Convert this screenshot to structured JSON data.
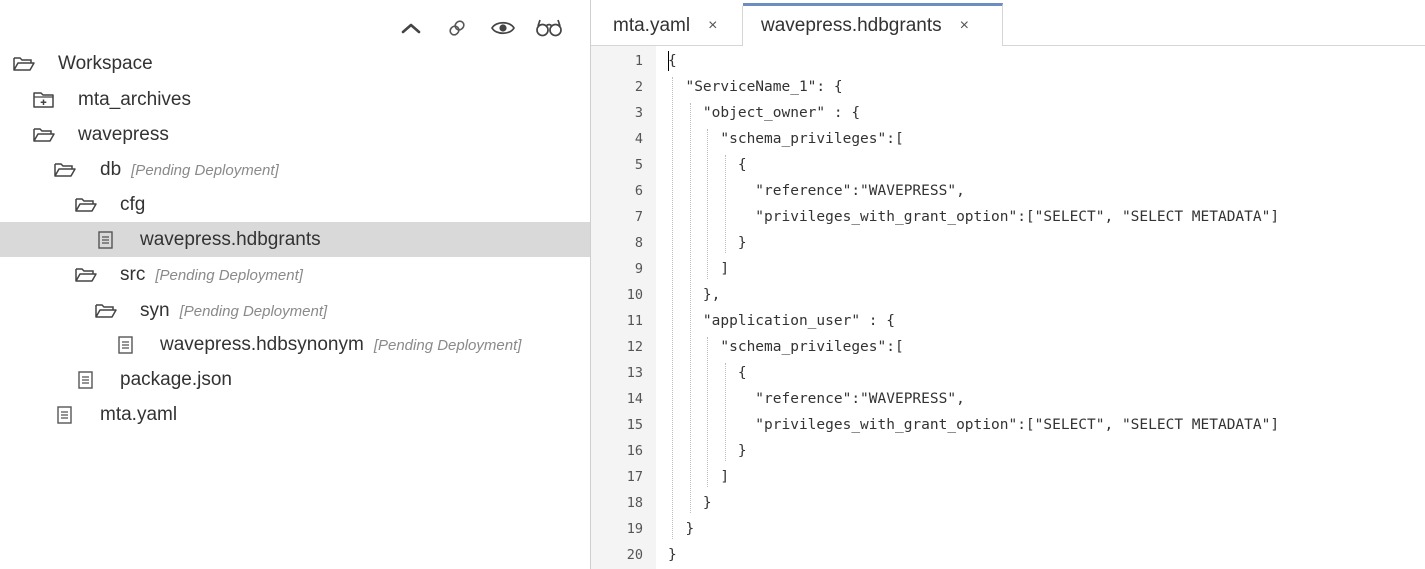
{
  "toolbar": {
    "icons": [
      "chevron-up-icon",
      "link-icon",
      "eye-icon",
      "glasses-icon"
    ]
  },
  "tree": {
    "items": [
      {
        "label": "Workspace",
        "tag": "",
        "icon": "folder-open-icon"
      },
      {
        "label": "mta_archives",
        "tag": "",
        "icon": "folder-plus-icon"
      },
      {
        "label": "wavepress",
        "tag": "",
        "icon": "folder-open-icon"
      },
      {
        "label": "db",
        "tag": "[Pending Deployment]",
        "icon": "folder-open-icon"
      },
      {
        "label": "cfg",
        "tag": "",
        "icon": "folder-open-icon"
      },
      {
        "label": "wavepress.hdbgrants",
        "tag": "",
        "icon": "file-icon",
        "selected": true
      },
      {
        "label": "src",
        "tag": "[Pending Deployment]",
        "icon": "folder-open-icon"
      },
      {
        "label": "syn",
        "tag": "[Pending Deployment]",
        "icon": "folder-open-icon"
      },
      {
        "label": "wavepress.hdbsynonym",
        "tag": "[Pending Deployment]",
        "icon": "file-icon"
      },
      {
        "label": "package.json",
        "tag": "",
        "icon": "file-icon"
      },
      {
        "label": "mta.yaml",
        "tag": "",
        "icon": "file-icon"
      }
    ]
  },
  "editor": {
    "tabs": [
      {
        "label": "mta.yaml",
        "close": "×",
        "active": false
      },
      {
        "label": "wavepress.hdbgrants",
        "close": "×",
        "active": true
      }
    ],
    "line_numbers": [
      "1",
      "2",
      "3",
      "4",
      "5",
      "6",
      "7",
      "8",
      "9",
      "10",
      "11",
      "12",
      "13",
      "14",
      "15",
      "16",
      "17",
      "18",
      "19",
      "20"
    ],
    "lines": [
      "{",
      "  \"ServiceName_1\": {",
      "    \"object_owner\" : {",
      "      \"schema_privileges\":[",
      "        {",
      "          \"reference\":\"WAVEPRESS\",",
      "          \"privileges_with_grant_option\":[\"SELECT\", \"SELECT METADATA\"]",
      "        }",
      "      ]",
      "    },",
      "    \"application_user\" : {",
      "      \"schema_privileges\":[",
      "        {",
      "          \"reference\":\"WAVEPRESS\",",
      "          \"privileges_with_grant_option\":[\"SELECT\", \"SELECT METADATA\"]",
      "        }",
      "      ]",
      "    }",
      "  }",
      "}"
    ]
  }
}
